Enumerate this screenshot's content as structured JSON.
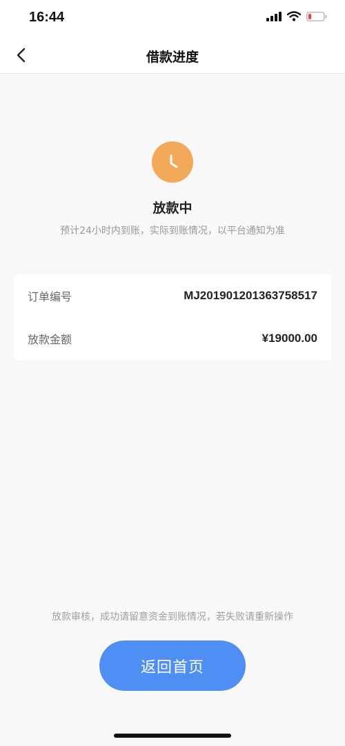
{
  "status_bar": {
    "time": "16:44",
    "icons": [
      "signal-icon",
      "wifi-icon",
      "battery-low-icon"
    ]
  },
  "nav": {
    "back_icon": "chevron-left-icon",
    "title": "借款进度"
  },
  "loan_status": {
    "icon": "clock-icon",
    "title": "放款中",
    "subtitle": "预计24小时内到账，实际到账情况，以平台通知为准"
  },
  "details": {
    "order_label": "订单编号",
    "order_value": "MJ201901201363758517",
    "amount_label": "放款金额",
    "amount_value": "¥19000.00"
  },
  "footer": {
    "note": "放款审核，成功请留意资金到账情况，若失败请重新操作",
    "home_button_label": "返回首页"
  },
  "colors": {
    "accent_orange": "#f2a95a",
    "button_blue": "#4f8ef2",
    "battery_red": "#e8453c"
  }
}
